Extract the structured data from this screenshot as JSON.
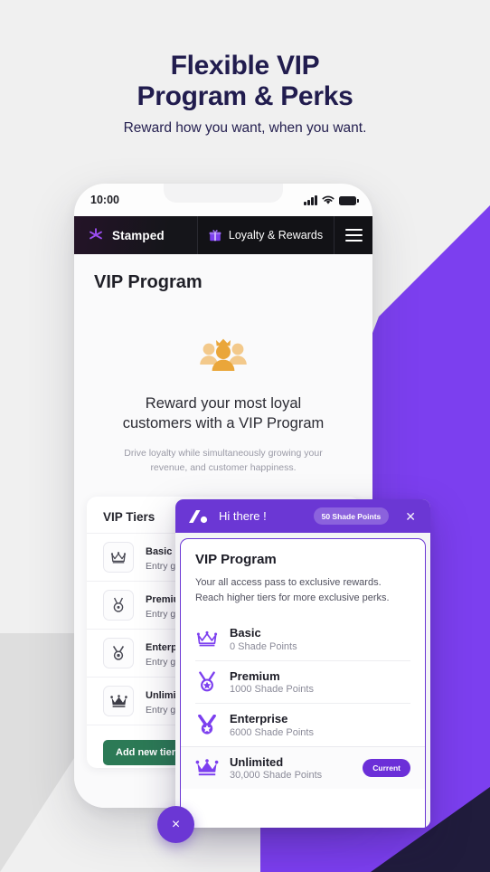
{
  "hero": {
    "headline_line1": "Flexible VIP",
    "headline_line2": "Program & Perks",
    "subhead": "Reward how you want, when you want."
  },
  "colors": {
    "brand_purple": "#6b37d4",
    "accent_purple": "#7c3fef",
    "headline_navy": "#211c4e",
    "dark_navy": "#201c3c",
    "green_button": "#2c7a56",
    "gold_icon": "#e8a33d"
  },
  "phone": {
    "status_bar": {
      "time": "10:00",
      "signal_icon": "signal-bars-icon",
      "wifi_icon": "wifi-icon",
      "battery_icon": "battery-icon"
    },
    "navbar": {
      "brand_label": "Stamped",
      "brand_logo_icon": "stamped-starburst-icon",
      "section_label": "Loyalty & Rewards",
      "section_icon": "gift-icon",
      "menu_icon": "hamburger-menu-icon"
    },
    "page_title": "VIP Program",
    "empty_state": {
      "illustration_icon": "vip-customers-group-icon",
      "title_line1": "Reward your most loyal",
      "title_line2": "customers with a VIP Program",
      "subtitle_line1": "Drive loyalty while simultaneously growing your",
      "subtitle_line2": "revenue, and customer happiness."
    },
    "tiers_card": {
      "title": "VIP Tiers",
      "add_button_label": "Add new tier",
      "rows": [
        {
          "icon": "crown-outline-icon",
          "name": "Basic",
          "goal": "Entry goal:"
        },
        {
          "icon": "medal-outline-icon",
          "name": "Premium",
          "goal": "Entry goal:"
        },
        {
          "icon": "medal-outline-icon",
          "name": "Enterprise",
          "goal": "Entry goal:"
        },
        {
          "icon": "crown-filled-icon",
          "name": "Unlimited",
          "goal": "Entry goal:"
        }
      ]
    }
  },
  "widget": {
    "header": {
      "logo_icon": "widget-slash-dot-logo-icon",
      "greeting": "Hi there !",
      "points_badge": "50 Shade Points",
      "close_icon": "close-icon"
    },
    "card": {
      "title": "VIP Program",
      "desc_line1": "Your all access pass to exclusive rewards.",
      "desc_line2": "Reach higher tiers for more exclusive perks.",
      "tiers": [
        {
          "icon": "crown-outline-icon",
          "name": "Basic",
          "points": "0 Shade Points",
          "badge": ""
        },
        {
          "icon": "medal-star-icon",
          "name": "Premium",
          "points": "1000 Shade Points",
          "badge": ""
        },
        {
          "icon": "medal-star-icon",
          "name": "Enterprise",
          "points": "6000 Shade Points",
          "badge": ""
        },
        {
          "icon": "crown-filled-icon",
          "name": "Unlimited",
          "points": "30,000 Shade Points",
          "badge": "Current"
        }
      ]
    }
  },
  "fab": {
    "icon": "close-icon",
    "label": "×"
  }
}
